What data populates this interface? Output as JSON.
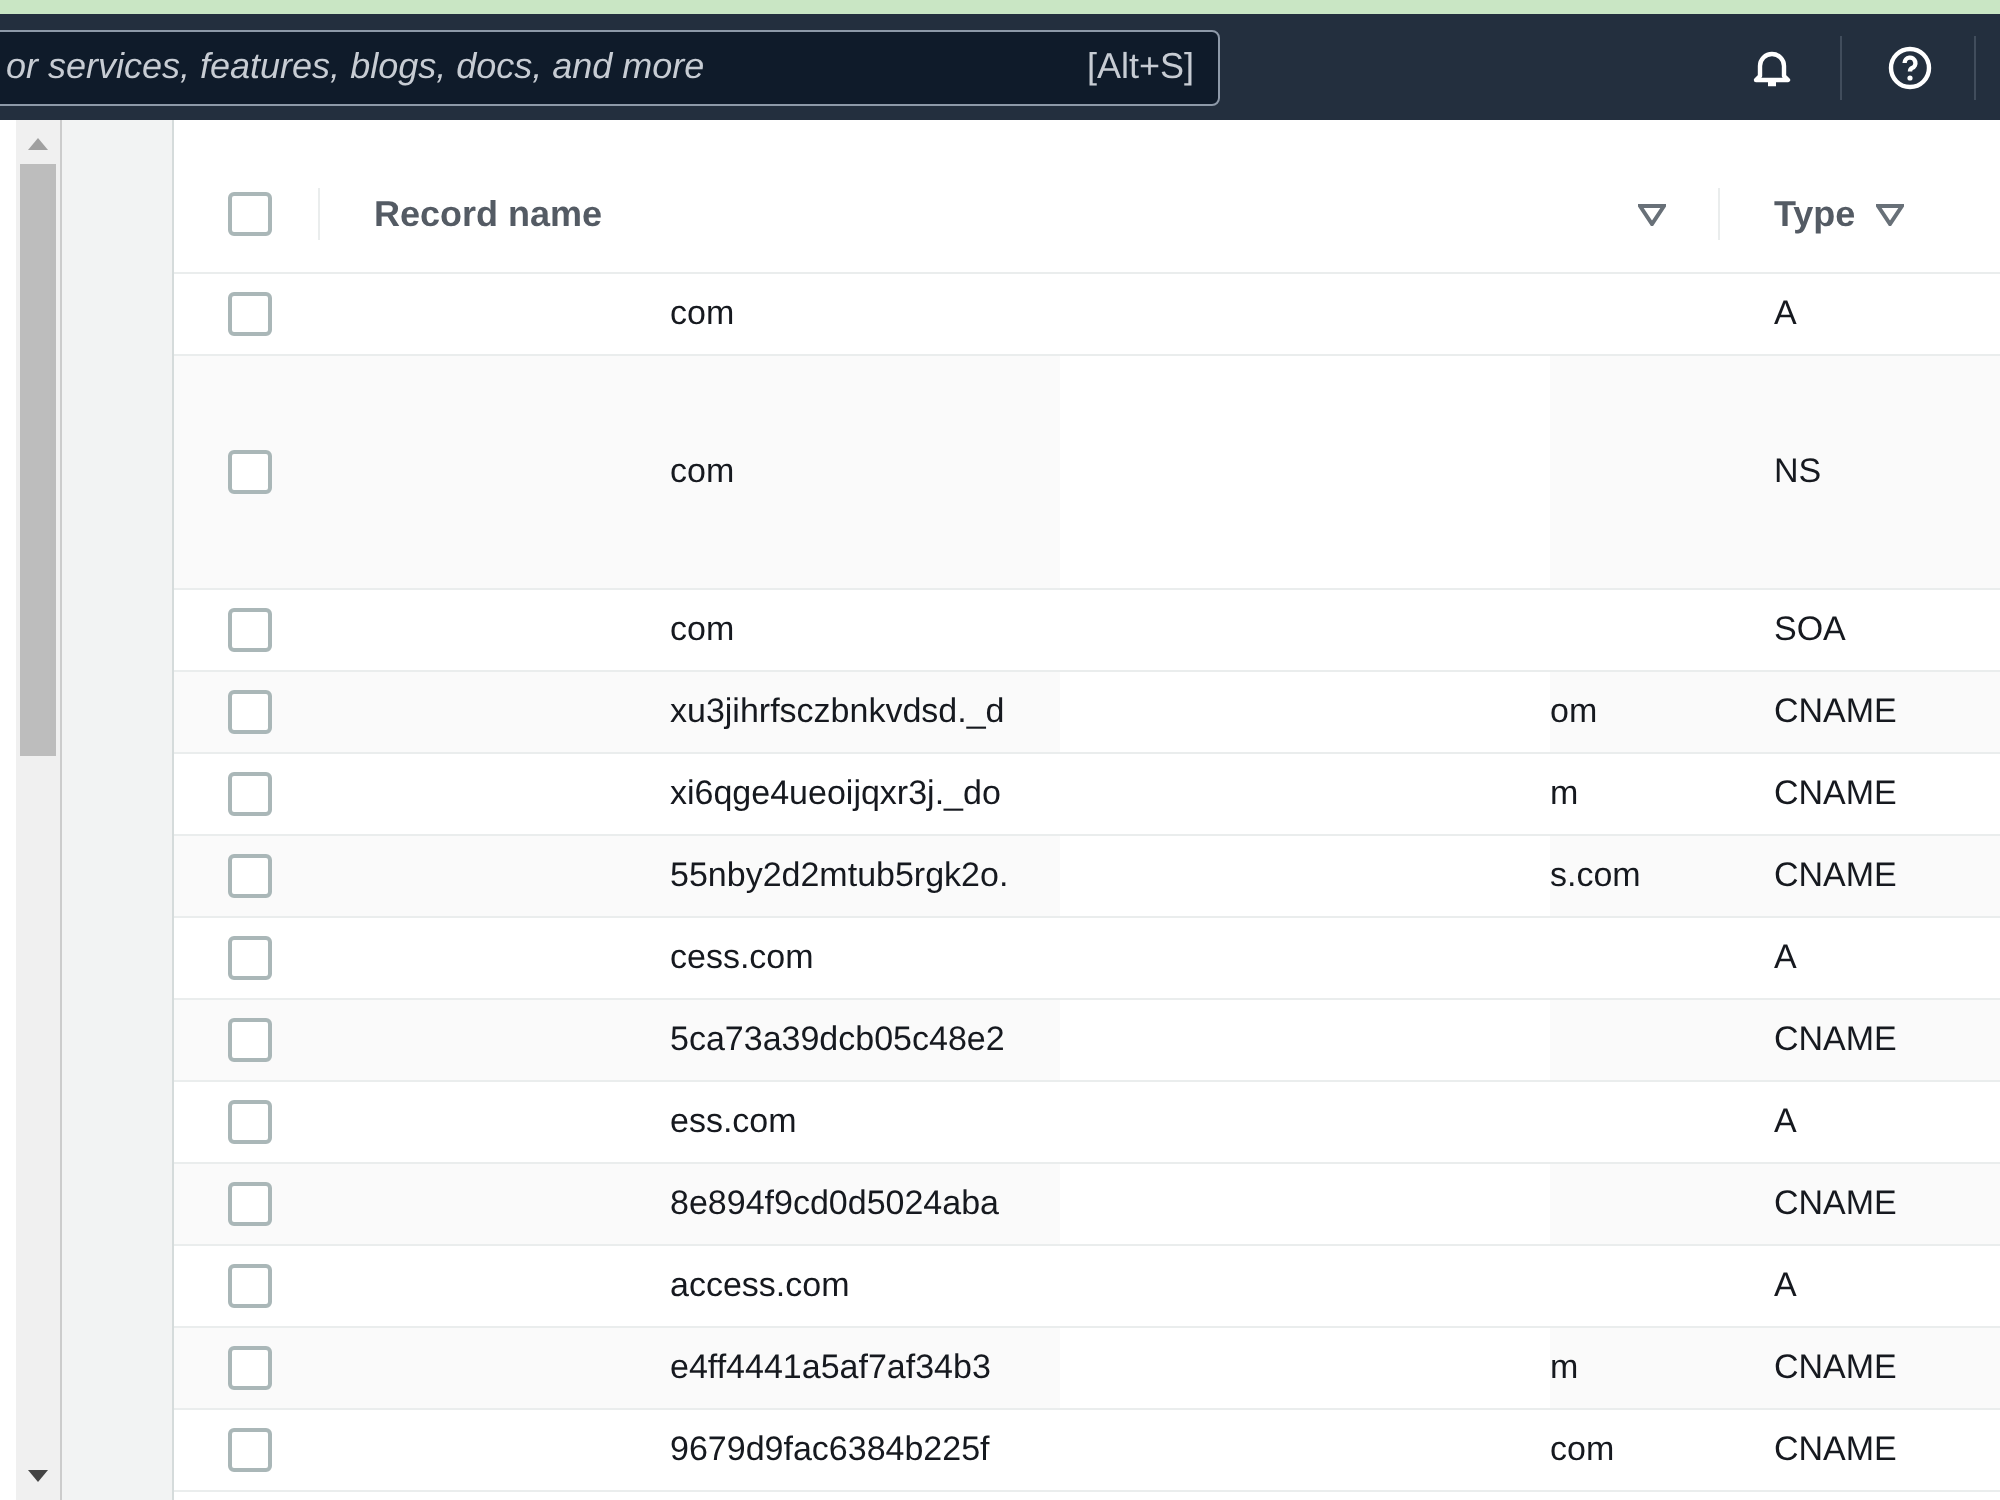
{
  "top_bar": {
    "search": {
      "placeholder": "or services, features, blogs, docs, and more",
      "shortcut": "[Alt+S]"
    }
  },
  "table": {
    "columns": [
      {
        "label": "Record name"
      },
      {
        "label": "Type"
      }
    ],
    "header_checked": false,
    "rows": [
      {
        "record_name": "com",
        "type": "A",
        "checked": false,
        "tall": false
      },
      {
        "record_name": "com",
        "type": "NS",
        "checked": false,
        "tall": true
      },
      {
        "record_name": "com",
        "type": "SOA",
        "checked": false,
        "tall": false
      },
      {
        "record_name": "xu3jihrfsczbnkvdsd._d",
        "column_3": "om",
        "type": "CNAME",
        "checked": false,
        "tall": false
      },
      {
        "record_name": "xi6qge4ueoijqxr3j._do",
        "column_3": "m",
        "type": "CNAME",
        "checked": false,
        "tall": false
      },
      {
        "record_name": "55nby2d2mtub5rgk2o.",
        "column_3": "s.com",
        "type": "CNAME",
        "checked": false,
        "tall": false
      },
      {
        "record_name": "cess.com",
        "type": "A",
        "checked": false,
        "tall": false
      },
      {
        "record_name": "5ca73a39dcb05c48e2",
        "type": "CNAME",
        "checked": false,
        "tall": false
      },
      {
        "record_name": "ess.com",
        "type": "A",
        "checked": false,
        "tall": false
      },
      {
        "record_name": "8e894f9cd0d5024aba",
        "type": "CNAME",
        "checked": false,
        "tall": false
      },
      {
        "record_name": "access.com",
        "type": "A",
        "checked": false,
        "tall": false
      },
      {
        "record_name": "e4ff4441a5af7af34b3",
        "column_3": "m",
        "type": "CNAME",
        "checked": false,
        "tall": false
      },
      {
        "record_name": "9679d9fac6384b225f",
        "column_3": "com",
        "type": "CNAME",
        "checked": false,
        "tall": false
      }
    ]
  }
}
